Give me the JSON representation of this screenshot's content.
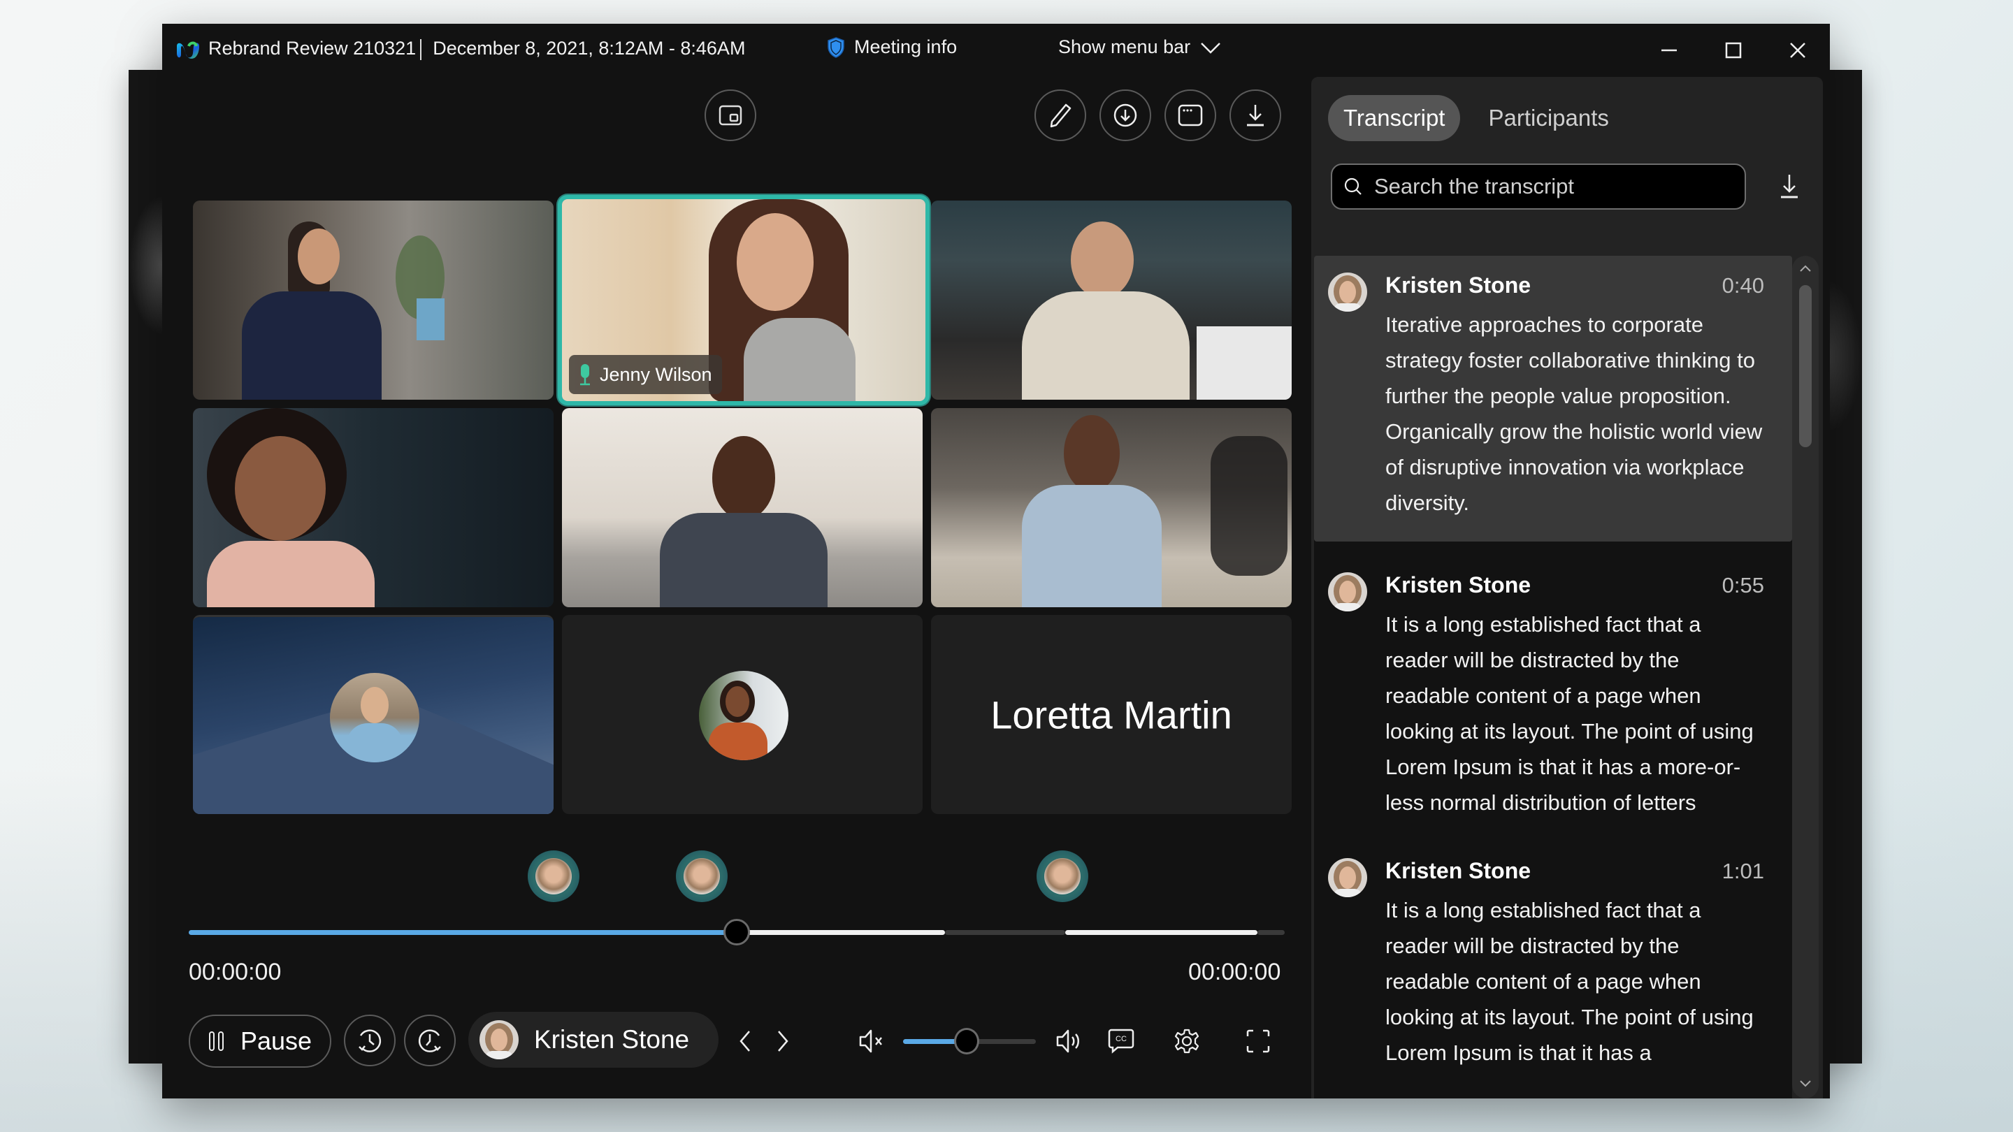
{
  "window": {
    "title": "Rebrand Review 210321",
    "datetime": "December 8, 2021, 8:12AM - 8:46AM",
    "meeting_info_label": "Meeting info",
    "show_menu_bar_label": "Show menu bar",
    "controls": {
      "minimize": "minimize-icon",
      "maximize": "maximize-icon",
      "close": "close-icon"
    }
  },
  "toolbar": {
    "left": [
      {
        "icon": "picture-in-picture-icon",
        "label": "Picture in picture"
      }
    ],
    "right": [
      {
        "icon": "pencil-icon",
        "label": "Edit"
      },
      {
        "icon": "circle-download-icon",
        "label": "Download"
      },
      {
        "icon": "window-more-icon",
        "label": "More"
      },
      {
        "icon": "download-icon",
        "label": "Save"
      }
    ]
  },
  "video_grid": {
    "tiles": [
      {
        "kind": "video",
        "name": "",
        "active": false
      },
      {
        "kind": "video",
        "name": "Jenny Wilson",
        "active": true,
        "mic_icon": "microphone-icon"
      },
      {
        "kind": "video",
        "name": "",
        "active": false
      },
      {
        "kind": "video",
        "name": "",
        "active": false
      },
      {
        "kind": "video",
        "name": "",
        "active": false
      },
      {
        "kind": "video",
        "name": "",
        "active": false
      },
      {
        "kind": "avatar-on-background",
        "name": "",
        "active": false
      },
      {
        "kind": "avatar",
        "name": "",
        "active": false
      },
      {
        "kind": "name-only",
        "name": "Loretta Martin",
        "active": false
      }
    ]
  },
  "timeline": {
    "progress": 0.5,
    "segments": [
      {
        "start": 0.0,
        "end": 0.5,
        "state": "played"
      },
      {
        "start": 0.5,
        "end": 0.69,
        "state": "speaker"
      },
      {
        "start": 0.69,
        "end": 0.8,
        "state": "other"
      },
      {
        "start": 0.8,
        "end": 0.975,
        "state": "speaker"
      },
      {
        "start": 0.975,
        "end": 1.0,
        "state": "other"
      }
    ],
    "markers": [
      {
        "position": 0.333,
        "speaker": "Kristen Stone"
      },
      {
        "position": 0.468,
        "speaker": "Kristen Stone"
      },
      {
        "position": 0.797,
        "speaker": "Kristen Stone"
      }
    ],
    "current_time": "00:00:00",
    "total_time": "00:00:00",
    "colors": {
      "played": "#5aa9e6",
      "speaker": "#f0f0f0",
      "other": "#3a3a3a"
    }
  },
  "controls": {
    "pause_label": "Pause",
    "rewind_icon": "rewind-clock-icon",
    "forward_icon": "forward-clock-icon",
    "speaker_filter": "Kristen Stone",
    "prev_icon": "chevron-left-icon",
    "next_icon": "chevron-right-icon",
    "mute_icon": "volume-mute-icon",
    "volume": 0.48,
    "volume_up_icon": "volume-up-icon",
    "captions_icon": "closed-captions-icon",
    "captions_label": "CC",
    "settings_icon": "gear-icon",
    "fullscreen_icon": "fullscreen-icon"
  },
  "panel": {
    "tabs": [
      {
        "label": "Transcript",
        "active": true
      },
      {
        "label": "Participants",
        "active": false
      }
    ],
    "search_placeholder": "Search the transcript",
    "download_icon": "download-icon",
    "entries": [
      {
        "speaker": "Kristen Stone",
        "time": "0:40",
        "highlighted": true,
        "text": "Iterative approaches to corporate strategy foster collaborative thinking to further the people value proposition. Organically grow the holistic world view of disruptive innovation via workplace diversity."
      },
      {
        "speaker": "Kristen Stone",
        "time": "0:55",
        "highlighted": false,
        "text": "It is a long established fact that a reader will be distracted by the readable content of a page when looking at its layout. The point of using Lorem Ipsum is that it has a more-or-less normal distribution of letters"
      },
      {
        "speaker": "Kristen Stone",
        "time": "1:01",
        "highlighted": false,
        "text": "It is a long established fact that a reader will be distracted by the readable content of a page when looking at its layout. The point of using Lorem Ipsum is that it has a"
      }
    ]
  },
  "colors": {
    "accent_blue": "#5aa9e6",
    "active_tile_border": "#2eb8a8",
    "shield_blue": "#2f8ff0",
    "mic_green": "#3ec9a0"
  }
}
